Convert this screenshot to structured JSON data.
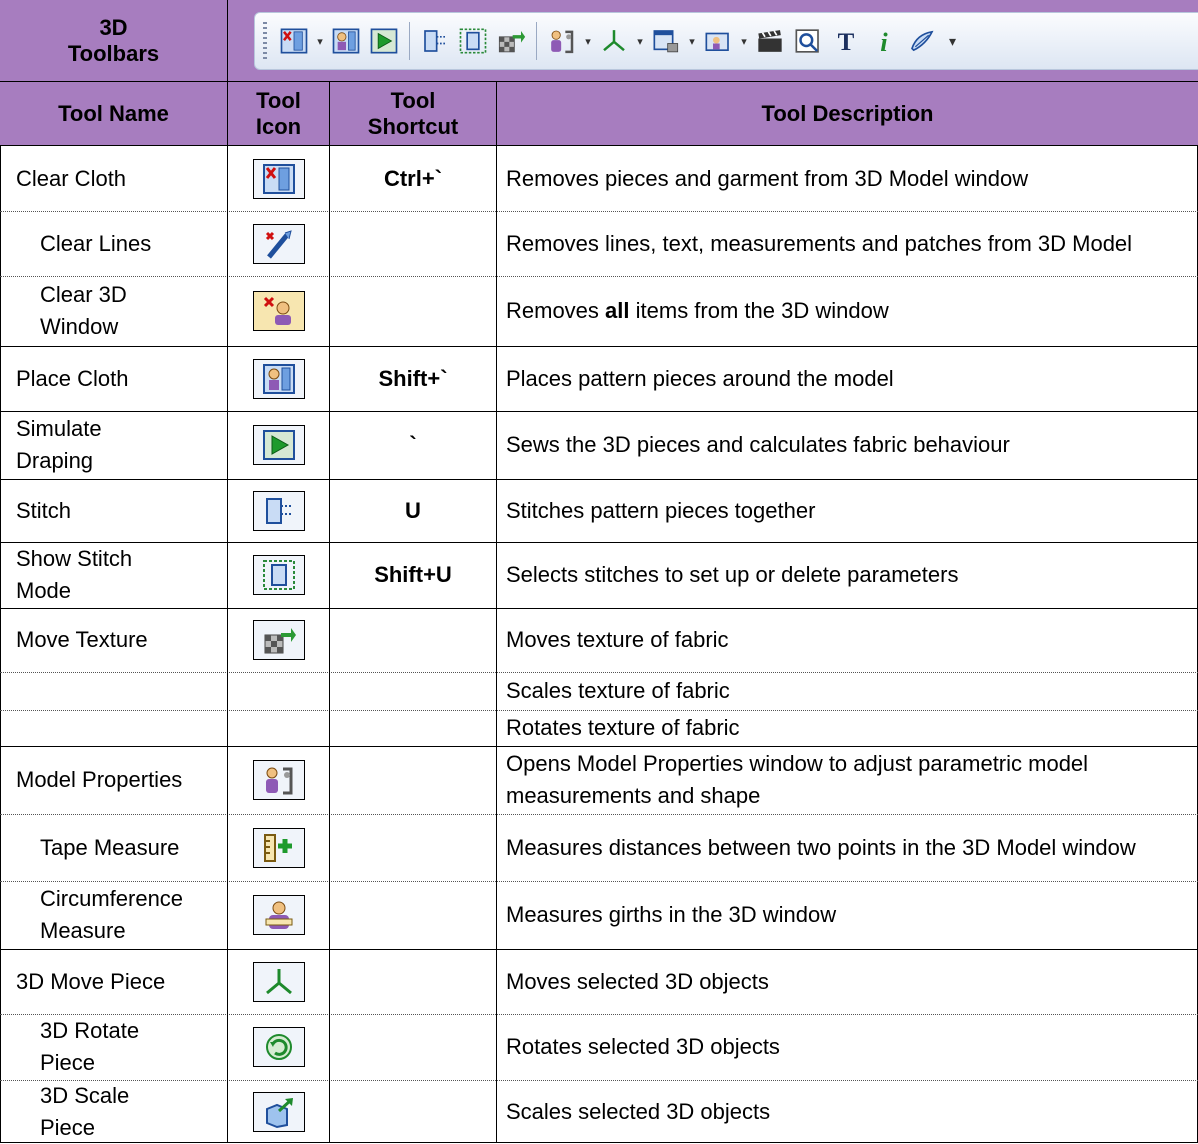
{
  "header": {
    "toolbars_label": "3D Toolbars",
    "col_name": "Tool Name",
    "col_icon": "Tool Icon",
    "col_shortcut": "Tool Shortcut",
    "col_description": "Tool Description"
  },
  "toolbar_icons": [
    "clear-cloth-icon",
    "place-cloth-icon",
    "simulate-draping-icon",
    "stitch-icon",
    "show-stitch-mode-icon",
    "move-texture-icon",
    "model-properties-icon",
    "3d-move-icon",
    "display-icon",
    "render-icon",
    "clapperboard-icon",
    "search-image-icon",
    "text-icon",
    "info-icon",
    "settings-icon"
  ],
  "rows": [
    {
      "name": "Clear Cloth",
      "icon": "clear-cloth-icon",
      "shortcut": "Ctrl+`",
      "description": "Removes pieces and garment from 3D Model window"
    },
    {
      "name": "Clear Lines",
      "icon": "clear-lines-icon",
      "shortcut": "",
      "description": "Removes lines, text, measurements and patches from 3D Model"
    },
    {
      "name": "Clear 3D Window",
      "icon": "clear-3d-window-icon",
      "shortcut": "",
      "description_pre": "Removes ",
      "description_bold": "all",
      "description_post": " items from the 3D window"
    },
    {
      "name": "Place Cloth",
      "icon": "place-cloth-icon",
      "shortcut": "Shift+`",
      "description": "Places pattern pieces around the model"
    },
    {
      "name": "Simulate Draping",
      "icon": "simulate-draping-icon",
      "shortcut": "`",
      "description": "Sews the 3D pieces and calculates fabric behaviour"
    },
    {
      "name": "Stitch",
      "icon": "stitch-icon",
      "shortcut": "U",
      "description": "Stitches pattern pieces together"
    },
    {
      "name": "Show Stitch Mode",
      "icon": "show-stitch-mode-icon",
      "shortcut": "Shift+U",
      "description": "Selects stitches to set up or delete parameters"
    },
    {
      "name": "Move Texture",
      "icon": "move-texture-icon",
      "shortcut": "",
      "description": "Moves texture of fabric"
    },
    {
      "name": "",
      "icon": "",
      "shortcut": "",
      "description": "Scales texture of fabric"
    },
    {
      "name": "",
      "icon": "",
      "shortcut": "",
      "description": "Rotates texture of fabric"
    },
    {
      "name": "Model Properties",
      "icon": "model-properties-icon",
      "shortcut": "",
      "description": "Opens Model Properties window to adjust parametric model measurements and shape"
    },
    {
      "name": "Tape Measure",
      "icon": "tape-measure-icon",
      "shortcut": "",
      "description": "Measures distances between two points in the 3D Model window"
    },
    {
      "name": "Circumference Measure",
      "icon": "circumference-measure-icon",
      "shortcut": "",
      "description": "Measures girths in the 3D window"
    },
    {
      "name": "3D Move Piece",
      "icon": "3d-move-icon",
      "shortcut": "",
      "description": "Moves selected 3D objects"
    },
    {
      "name": "3D Rotate Piece",
      "icon": "3d-rotate-icon",
      "shortcut": "",
      "description": "Rotates selected 3D objects"
    },
    {
      "name": "3D Scale Piece",
      "icon": "3d-scale-icon",
      "shortcut": "",
      "description": "Scales selected 3D objects"
    }
  ]
}
